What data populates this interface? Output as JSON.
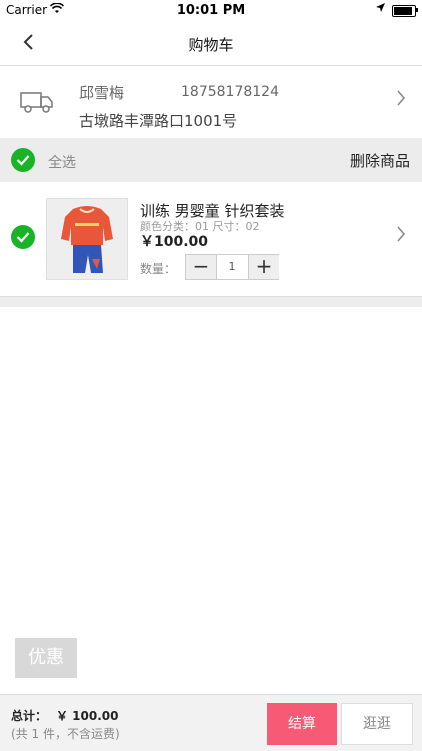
{
  "status_bar": {
    "carrier": "Carrier",
    "wifi": "wifi-icon",
    "time": "10:01 PM"
  },
  "nav": {
    "back_icon": "‹",
    "title": "购物车"
  },
  "address": {
    "name": "邱雪梅",
    "phone": "18758178124",
    "street": "古墩路丰潭路口1001号"
  },
  "select_bar": {
    "select_all": "全选",
    "delete": "删除商品"
  },
  "item": {
    "title": "训练 男婴童 针织套装",
    "spec": "颜色分类：01   尺寸：02",
    "price": "￥100.00",
    "qty_label": "数量：",
    "qty": "1",
    "minus": "−",
    "plus": "+"
  },
  "coupon": "优惠",
  "footer": {
    "total_label": "总计：",
    "total_value": "￥ 100.00",
    "note": "(共 1 件，不含运费)",
    "checkout": "结算",
    "browse": "逛逛"
  },
  "colors": {
    "accent": "#f75a74",
    "check": "#19b328"
  }
}
